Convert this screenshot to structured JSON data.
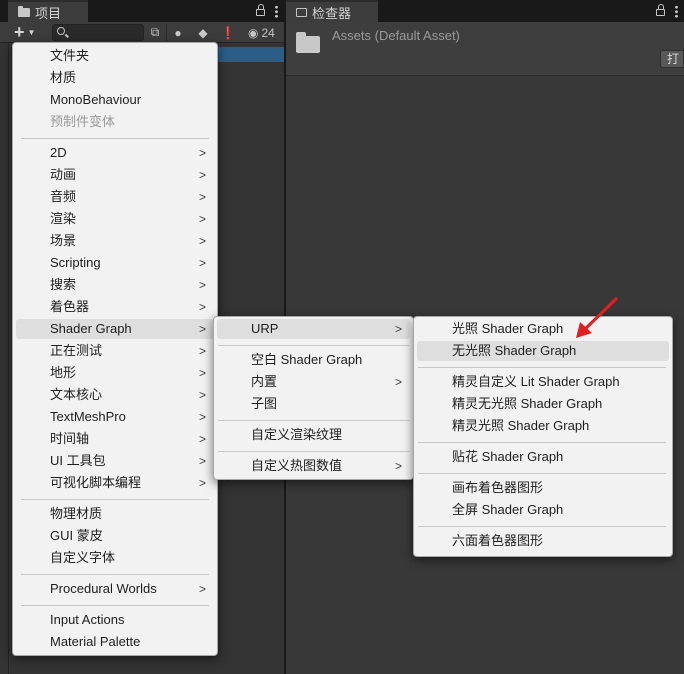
{
  "project": {
    "tab_label": "项目",
    "search_placeholder": "",
    "visible_count": "24"
  },
  "inspector": {
    "tab_label": "检查器",
    "title": "Assets (Default Asset)",
    "open_button_label": "打"
  },
  "main_menu": {
    "items": [
      {
        "label": "文件夹"
      },
      {
        "label": "材质"
      },
      {
        "label": "MonoBehaviour"
      },
      {
        "label": "预制件变体",
        "disabled": true
      },
      {
        "label": "2D",
        "submenu": true
      },
      {
        "label": "动画",
        "submenu": true
      },
      {
        "label": "音频",
        "submenu": true
      },
      {
        "label": "渲染",
        "submenu": true
      },
      {
        "label": "场景",
        "submenu": true
      },
      {
        "label": "Scripting",
        "submenu": true
      },
      {
        "label": "搜索",
        "submenu": true
      },
      {
        "label": "着色器",
        "submenu": true
      },
      {
        "label": "Shader Graph",
        "submenu": true,
        "highlighted": true
      },
      {
        "label": "正在测试",
        "submenu": true
      },
      {
        "label": "地形",
        "submenu": true
      },
      {
        "label": "文本核心",
        "submenu": true
      },
      {
        "label": "TextMeshPro",
        "submenu": true
      },
      {
        "label": "时间轴",
        "submenu": true
      },
      {
        "label": "UI 工具包",
        "submenu": true
      },
      {
        "label": "可视化脚本编程",
        "submenu": true
      },
      {
        "label": "物理材质"
      },
      {
        "label": "GUI 蒙皮"
      },
      {
        "label": "自定义字体"
      },
      {
        "label": "Procedural Worlds",
        "submenu": true
      },
      {
        "label": "Input Actions"
      },
      {
        "label": "Material Palette"
      }
    ]
  },
  "shader_graph_menu": {
    "items": [
      {
        "label": "URP",
        "submenu": true,
        "highlighted": true
      },
      {
        "label": "空白 Shader Graph"
      },
      {
        "label": "内置",
        "submenu": true
      },
      {
        "label": "子图"
      },
      {
        "label": "自定义渲染纹理"
      },
      {
        "label": "自定义热图数值",
        "submenu": true
      }
    ]
  },
  "urp_menu": {
    "items": [
      {
        "label": "光照 Shader Graph"
      },
      {
        "label": "无光照 Shader Graph",
        "highlighted": true
      },
      {
        "label": "精灵自定义 Lit Shader Graph"
      },
      {
        "label": "精灵无光照 Shader Graph"
      },
      {
        "label": "精灵光照 Shader Graph"
      },
      {
        "label": "贴花 Shader Graph"
      },
      {
        "label": "画布着色器图形"
      },
      {
        "label": "全屏 Shader Graph"
      },
      {
        "label": "六面着色器图形"
      }
    ]
  },
  "colors": {
    "editor_bg": "#383838",
    "menu_bg": "#f2f2f2",
    "highlight": "#dedede",
    "selection_blue": "#2c5d87",
    "annotation_red": "#e02020"
  }
}
